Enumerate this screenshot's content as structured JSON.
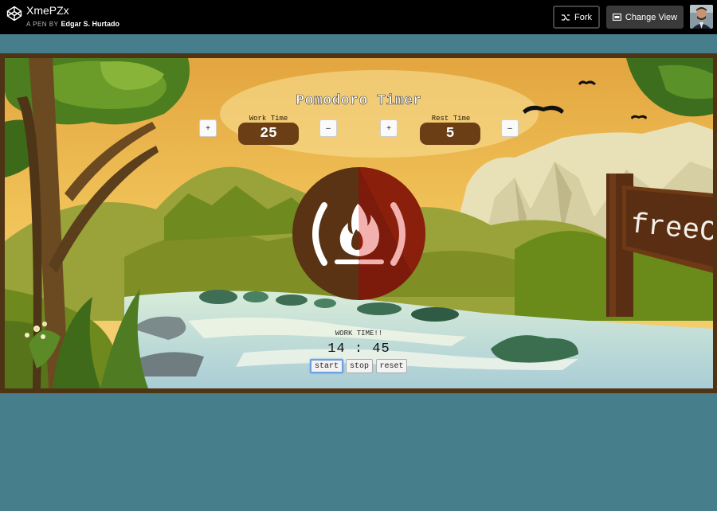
{
  "header": {
    "pen_title": "XmePZx",
    "pen_by": "A PEN BY",
    "author": "Edgar S. Hurtado",
    "fork_label": "Fork",
    "change_view_label": "Change View"
  },
  "app": {
    "title": "Pomodoro Timer",
    "work": {
      "label": "Work Time",
      "value": "25",
      "plus": "+",
      "minus": "–"
    },
    "rest": {
      "label": "Rest Time",
      "value": "5",
      "plus": "+",
      "minus": "–"
    },
    "status": "WORK TIME!!",
    "clock": "14 : 45",
    "buttons": {
      "start": "start",
      "stop": "stop",
      "reset": "reset"
    },
    "sign_text": "freeCo"
  },
  "colors": {
    "sky": "#e9b548",
    "pill": "#6b3e16",
    "circle_left": "#5a3214",
    "circle_right": "#8a1f0c",
    "page_bg": "#467e8c"
  }
}
